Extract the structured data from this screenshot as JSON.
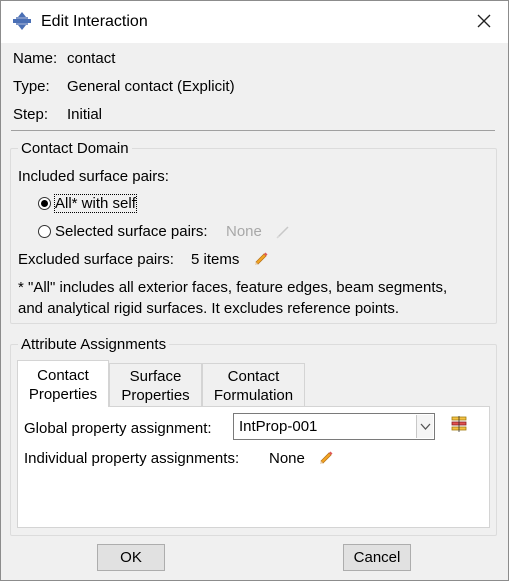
{
  "window": {
    "title": "Edit Interaction"
  },
  "info": {
    "name_label": "Name:",
    "name_value": "contact",
    "type_label": "Type:",
    "type_value": "General contact (Explicit)",
    "step_label": "Step:",
    "step_value": "Initial"
  },
  "contact_domain": {
    "title": "Contact Domain",
    "included_label": "Included surface pairs:",
    "radio_all": "All* with self",
    "radio_selected": "Selected surface pairs:",
    "selected_value": "None",
    "excluded_label": "Excluded surface pairs:",
    "excluded_value": "5 items",
    "note_line1": "* \"All\" includes all exterior faces, feature edges, beam segments,",
    "note_line2": "and analytical rigid surfaces. It excludes reference points."
  },
  "attributes": {
    "title": "Attribute Assignments",
    "tabs": [
      {
        "line1": "Contact",
        "line2": "Properties"
      },
      {
        "line1": "Surface",
        "line2": "Properties"
      },
      {
        "line1": "Contact",
        "line2": "Formulation"
      }
    ],
    "global_label": "Global property assignment:",
    "global_value": "IntProp-001",
    "individual_label": "Individual property assignments:",
    "individual_value": "None"
  },
  "buttons": {
    "ok": "OK",
    "cancel": "Cancel"
  }
}
